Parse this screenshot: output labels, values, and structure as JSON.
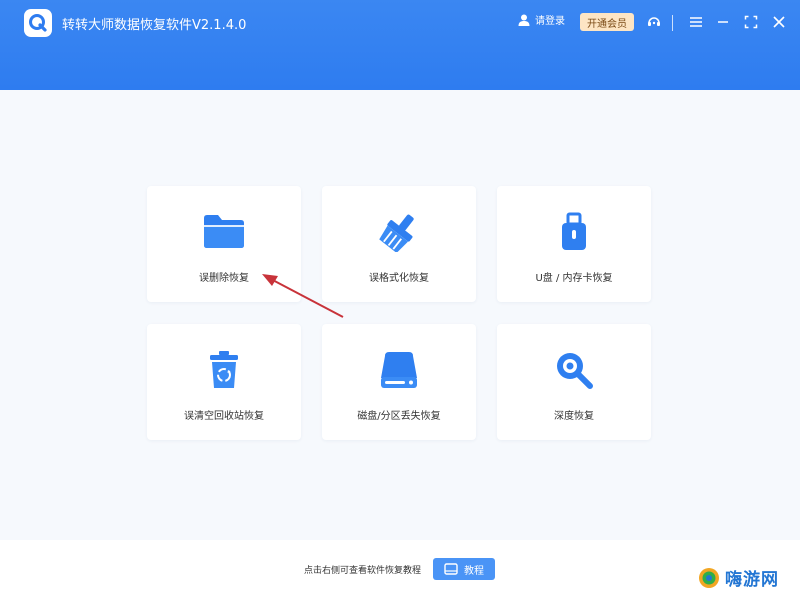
{
  "app": {
    "title": "转转大师数据恢复软件V2.1.4.0"
  },
  "header": {
    "login_label": "请登录",
    "vip_label": "开通会员",
    "icons": [
      "user-icon",
      "service-icon",
      "menu-icon",
      "minimize-icon",
      "maximize-icon",
      "close-icon"
    ]
  },
  "recovery_modes": [
    {
      "label": "误删除恢复",
      "icon": "folder-icon"
    },
    {
      "label": "误格式化恢复",
      "icon": "broom-icon"
    },
    {
      "label": "U盘 / 内存卡恢复",
      "icon": "usb-drive-icon"
    },
    {
      "label": "误清空回收站恢复",
      "icon": "recycle-bin-icon"
    },
    {
      "label": "磁盘/分区丢失恢复",
      "icon": "hard-disk-icon"
    },
    {
      "label": "深度恢复",
      "icon": "magnifier-icon"
    }
  ],
  "footer": {
    "hint_text": "点击右侧可查看软件恢复教程",
    "tutorial_label": "教程"
  },
  "watermark": {
    "text": "嗨游网"
  },
  "colors": {
    "brand_blue": "#2e7cf0",
    "accent": "#4a94f6",
    "vip_bg": "#fde5c4",
    "arrow": "#c8333a"
  }
}
